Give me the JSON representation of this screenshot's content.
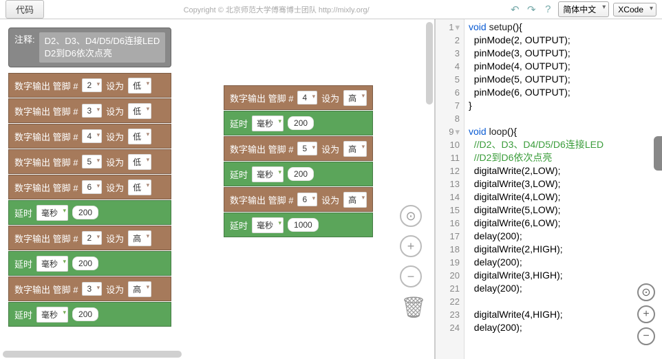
{
  "toolbar": {
    "code_btn": "代码",
    "copyright": "Copyright © 北京师范大学傅骞博士团队 http://mixly.org/",
    "lang": "简体中文",
    "theme": "XCode"
  },
  "comment": {
    "label": "注释:",
    "line1": "D2、D3、D4/D5/D6连接LED",
    "line2": "D2到D6依次点亮"
  },
  "labels": {
    "digital_out": "数字输出 管脚 #",
    "set_to": "设为",
    "low": "低",
    "high": "高",
    "delay": "延时",
    "ms": "毫秒"
  },
  "col1_init": [
    {
      "pin": "2",
      "v": "低"
    },
    {
      "pin": "3",
      "v": "低"
    },
    {
      "pin": "4",
      "v": "低"
    },
    {
      "pin": "5",
      "v": "低"
    },
    {
      "pin": "6",
      "v": "低"
    }
  ],
  "col1_delay1": "200",
  "col1_seq": [
    {
      "pin": "2",
      "d": "200"
    },
    {
      "pin": "3",
      "d": "200"
    }
  ],
  "col2_seq": [
    {
      "pin": "4",
      "d": "200"
    },
    {
      "pin": "5",
      "d": "200"
    },
    {
      "pin": "6",
      "d": "1000"
    }
  ],
  "code_lines": [
    {
      "n": 1,
      "h": "<span class='kw'>void</span> <span class='fn'>setup</span>(){",
      "a": 1
    },
    {
      "n": 2,
      "h": "  pinMode(2, OUTPUT);"
    },
    {
      "n": 3,
      "h": "  pinMode(3, OUTPUT);"
    },
    {
      "n": 4,
      "h": "  pinMode(4, OUTPUT);"
    },
    {
      "n": 5,
      "h": "  pinMode(5, OUTPUT);"
    },
    {
      "n": 6,
      "h": "  pinMode(6, OUTPUT);"
    },
    {
      "n": 7,
      "h": "}"
    },
    {
      "n": 8,
      "h": ""
    },
    {
      "n": 9,
      "h": "<span class='kw'>void</span> <span class='fn'>loop</span>(){",
      "a": 1
    },
    {
      "n": 10,
      "h": "  <span class='cm'>//D2、D3、D4/D5/D6连接LED</span>"
    },
    {
      "n": 11,
      "h": "  <span class='cm'>//D2到D6依次点亮</span>"
    },
    {
      "n": 12,
      "h": "  digitalWrite(2,LOW);"
    },
    {
      "n": 13,
      "h": "  digitalWrite(3,LOW);"
    },
    {
      "n": 14,
      "h": "  digitalWrite(4,LOW);"
    },
    {
      "n": 15,
      "h": "  digitalWrite(5,LOW);"
    },
    {
      "n": 16,
      "h": "  digitalWrite(6,LOW);"
    },
    {
      "n": 17,
      "h": "  delay(200);"
    },
    {
      "n": 18,
      "h": "  digitalWrite(2,HIGH);"
    },
    {
      "n": 19,
      "h": "  delay(200);"
    },
    {
      "n": 20,
      "h": "  digitalWrite(3,HIGH);"
    },
    {
      "n": 21,
      "h": "  delay(200);"
    },
    {
      "n": 22,
      "h": ""
    },
    {
      "n": 23,
      "h": "  digitalWrite(4,HIGH);"
    },
    {
      "n": 24,
      "h": "  delay(200);"
    }
  ]
}
